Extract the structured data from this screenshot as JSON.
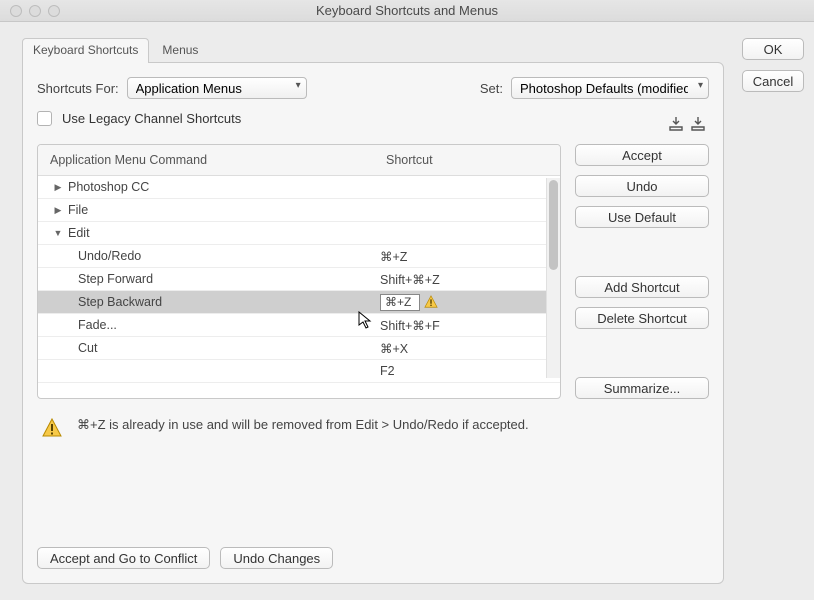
{
  "window": {
    "title": "Keyboard Shortcuts and Menus"
  },
  "tabs": {
    "shortcuts": "Keyboard Shortcuts",
    "menus": "Menus"
  },
  "topRow": {
    "shortcuts_for_label": "Shortcuts For:",
    "shortcuts_for_value": "Application Menus",
    "set_label": "Set:",
    "set_value": "Photoshop Defaults (modified)"
  },
  "legacy_label": "Use Legacy Channel Shortcuts",
  "columns": {
    "command": "Application Menu Command",
    "shortcut": "Shortcut"
  },
  "rows": [
    {
      "type": "group",
      "label": "Photoshop CC",
      "open": false
    },
    {
      "type": "group",
      "label": "File",
      "open": false
    },
    {
      "type": "group",
      "label": "Edit",
      "open": true
    },
    {
      "type": "item",
      "label": "Undo/Redo",
      "shortcut": "⌘+Z"
    },
    {
      "type": "item",
      "label": "Step Forward",
      "shortcut": "Shift+⌘+Z"
    },
    {
      "type": "item",
      "label": "Step Backward",
      "shortcut": "⌘+Z",
      "selected": true,
      "editing": true,
      "warn": true
    },
    {
      "type": "item",
      "label": "Fade...",
      "shortcut": "Shift+⌘+F"
    },
    {
      "type": "item",
      "label": "Cut",
      "shortcut": "⌘+X"
    },
    {
      "type": "item",
      "label": "",
      "shortcut": "F2"
    }
  ],
  "side": {
    "accept": "Accept",
    "undo": "Undo",
    "use_default": "Use Default",
    "add_shortcut": "Add Shortcut",
    "delete_shortcut": "Delete Shortcut",
    "summarize": "Summarize..."
  },
  "warning_msg": "⌘+Z is already in use and will be removed from Edit > Undo/Redo if accepted.",
  "bottom": {
    "accept_go": "Accept and Go to Conflict",
    "undo_changes": "Undo Changes"
  },
  "right": {
    "ok": "OK",
    "cancel": "Cancel"
  }
}
